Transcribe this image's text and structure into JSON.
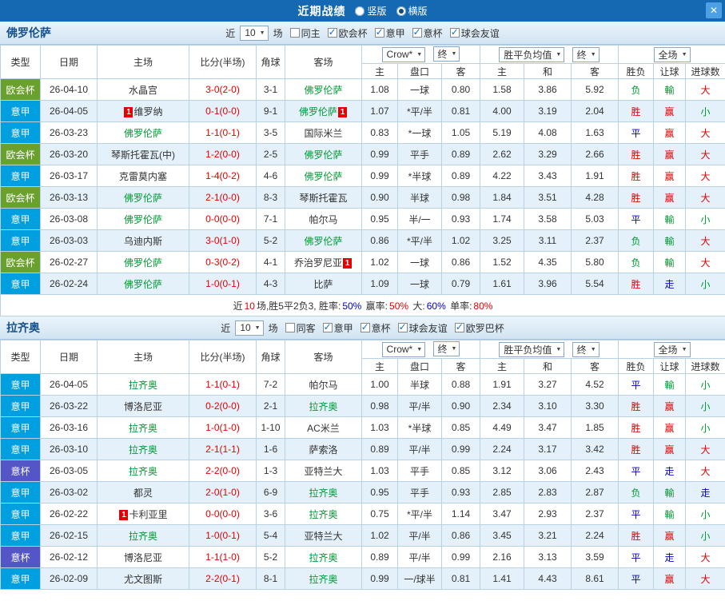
{
  "top_bar": {
    "title": "近期战绩",
    "layout_options": [
      {
        "label": "竖版",
        "selected": false
      },
      {
        "label": "横版",
        "selected": true
      }
    ],
    "close_label": "✕"
  },
  "labels": {
    "near": "近",
    "games": "场",
    "red_card": "1"
  },
  "columns": {
    "type": "类型",
    "date": "日期",
    "home": "主场",
    "score": "比分(半场)",
    "corner": "角球",
    "away": "客场",
    "ah_home": "主",
    "handicap": "盘口",
    "ah_away": "客",
    "odds_home": "主",
    "odds_draw": "和",
    "odds_away": "客",
    "wdl": "胜负",
    "ah_result": "让球",
    "goals": "进球数"
  },
  "colors": {
    "top_bar": "#1568b2",
    "type_badges": {
      "欧会杯": "#6aa02c",
      "意甲": "#00a0e0",
      "意杯": "#5456c8"
    },
    "results": {
      "r": "#e60000",
      "g": "#009933",
      "b": "#0000cc"
    },
    "score": "#e60000",
    "self_team": "#009933"
  },
  "sections": [
    {
      "team": "佛罗伦萨",
      "filter": {
        "count": "10",
        "checkboxes": [
          {
            "label": "同主",
            "checked": false
          },
          {
            "label": "欧会杯",
            "checked": true
          },
          {
            "label": "意甲",
            "checked": true
          },
          {
            "label": "意杯",
            "checked": true
          },
          {
            "label": "球会友谊",
            "checked": true
          }
        ]
      },
      "dropdowns": {
        "source": "Crow*",
        "final1": "终",
        "avg": "胜平负均值",
        "final2": "终",
        "scope": "全场"
      },
      "rows": [
        {
          "type": "欧会杯",
          "date": "26-04-10",
          "home": {
            "name": "水晶宫"
          },
          "score": "3-0(2-0)",
          "corner": "3-1",
          "away": {
            "name": "佛罗伦萨",
            "self": true
          },
          "ah": [
            "1.08",
            "一球",
            "0.80"
          ],
          "odds": [
            "1.58",
            "3.86",
            "5.92"
          ],
          "res": [
            [
              "负",
              "g"
            ],
            [
              "輸",
              "g"
            ],
            [
              "大",
              "r"
            ]
          ]
        },
        {
          "type": "意甲",
          "date": "26-04-05",
          "home": {
            "name": "维罗纳",
            "rc": "before"
          },
          "score": "0-1(0-0)",
          "corner": "9-1",
          "away": {
            "name": "佛罗伦萨",
            "self": true,
            "rc": "after"
          },
          "ah": [
            "1.07",
            "*平/半",
            "0.81"
          ],
          "odds": [
            "4.00",
            "3.19",
            "2.04"
          ],
          "res": [
            [
              "胜",
              "r"
            ],
            [
              "赢",
              "r"
            ],
            [
              "小",
              "g"
            ]
          ]
        },
        {
          "type": "意甲",
          "date": "26-03-23",
          "home": {
            "name": "佛罗伦萨",
            "self": true
          },
          "score": "1-1(0-1)",
          "corner": "3-5",
          "away": {
            "name": "国际米兰"
          },
          "ah": [
            "0.83",
            "*一球",
            "1.05"
          ],
          "odds": [
            "5.19",
            "4.08",
            "1.63"
          ],
          "res": [
            [
              "平",
              "b"
            ],
            [
              "赢",
              "r"
            ],
            [
              "大",
              "r"
            ]
          ]
        },
        {
          "type": "欧会杯",
          "date": "26-03-20",
          "home": {
            "name": "琴斯托霍瓦(中)"
          },
          "score": "1-2(0-0)",
          "corner": "2-5",
          "away": {
            "name": "佛罗伦萨",
            "self": true
          },
          "ah": [
            "0.99",
            "平手",
            "0.89"
          ],
          "odds": [
            "2.62",
            "3.29",
            "2.66"
          ],
          "res": [
            [
              "胜",
              "r"
            ],
            [
              "赢",
              "r"
            ],
            [
              "大",
              "r"
            ]
          ]
        },
        {
          "type": "意甲",
          "date": "26-03-17",
          "home": {
            "name": "克雷莫内塞"
          },
          "score": "1-4(0-2)",
          "corner": "4-6",
          "away": {
            "name": "佛罗伦萨",
            "self": true
          },
          "ah": [
            "0.99",
            "*半球",
            "0.89"
          ],
          "odds": [
            "4.22",
            "3.43",
            "1.91"
          ],
          "res": [
            [
              "胜",
              "r"
            ],
            [
              "赢",
              "r"
            ],
            [
              "大",
              "r"
            ]
          ]
        },
        {
          "type": "欧会杯",
          "date": "26-03-13",
          "home": {
            "name": "佛罗伦萨",
            "self": true
          },
          "score": "2-1(0-0)",
          "corner": "8-3",
          "away": {
            "name": "琴斯托霍瓦"
          },
          "ah": [
            "0.90",
            "半球",
            "0.98"
          ],
          "odds": [
            "1.84",
            "3.51",
            "4.28"
          ],
          "res": [
            [
              "胜",
              "r"
            ],
            [
              "赢",
              "r"
            ],
            [
              "大",
              "r"
            ]
          ]
        },
        {
          "type": "意甲",
          "date": "26-03-08",
          "home": {
            "name": "佛罗伦萨",
            "self": true
          },
          "score": "0-0(0-0)",
          "corner": "7-1",
          "away": {
            "name": "帕尔马"
          },
          "ah": [
            "0.95",
            "半/一",
            "0.93"
          ],
          "odds": [
            "1.74",
            "3.58",
            "5.03"
          ],
          "res": [
            [
              "平",
              "b"
            ],
            [
              "輸",
              "g"
            ],
            [
              "小",
              "g"
            ]
          ]
        },
        {
          "type": "意甲",
          "date": "26-03-03",
          "home": {
            "name": "乌迪内斯"
          },
          "score": "3-0(1-0)",
          "corner": "5-2",
          "away": {
            "name": "佛罗伦萨",
            "self": true
          },
          "ah": [
            "0.86",
            "*平/半",
            "1.02"
          ],
          "odds": [
            "3.25",
            "3.11",
            "2.37"
          ],
          "res": [
            [
              "负",
              "g"
            ],
            [
              "輸",
              "g"
            ],
            [
              "大",
              "r"
            ]
          ]
        },
        {
          "type": "欧会杯",
          "date": "26-02-27",
          "home": {
            "name": "佛罗伦萨",
            "self": true
          },
          "score": "0-3(0-2)",
          "corner": "4-1",
          "away": {
            "name": "乔治罗尼亚",
            "rc": "after"
          },
          "ah": [
            "1.02",
            "一球",
            "0.86"
          ],
          "odds": [
            "1.52",
            "4.35",
            "5.80"
          ],
          "res": [
            [
              "负",
              "g"
            ],
            [
              "輸",
              "g"
            ],
            [
              "大",
              "r"
            ]
          ]
        },
        {
          "type": "意甲",
          "date": "26-02-24",
          "home": {
            "name": "佛罗伦萨",
            "self": true
          },
          "score": "1-0(0-1)",
          "corner": "4-3",
          "away": {
            "name": "比萨"
          },
          "ah": [
            "1.09",
            "一球",
            "0.79"
          ],
          "odds": [
            "1.61",
            "3.96",
            "5.54"
          ],
          "res": [
            [
              "胜",
              "r"
            ],
            [
              "走",
              "b"
            ],
            [
              "小",
              "g"
            ]
          ]
        }
      ],
      "summary": [
        {
          "t": "近",
          "c": "#333333"
        },
        {
          "t": "10",
          "c": "#e60000"
        },
        {
          "t": "场,胜5平2负3, 胜率:",
          "c": "#333333"
        },
        {
          "t": "50%",
          "c": "#0000cc"
        },
        {
          "t": " 赢率:",
          "c": "#333333"
        },
        {
          "t": "50%",
          "c": "#e60000"
        },
        {
          "t": " 大:",
          "c": "#333333"
        },
        {
          "t": "60%",
          "c": "#0000cc"
        },
        {
          "t": " 单率:",
          "c": "#333333"
        },
        {
          "t": "80%",
          "c": "#e60000"
        }
      ]
    },
    {
      "team": "拉齐奥",
      "filter": {
        "count": "10",
        "checkboxes": [
          {
            "label": "同客",
            "checked": false
          },
          {
            "label": "意甲",
            "checked": true
          },
          {
            "label": "意杯",
            "checked": true
          },
          {
            "label": "球会友谊",
            "checked": true
          },
          {
            "label": "欧罗巴杯",
            "checked": true
          }
        ]
      },
      "dropdowns": {
        "source": "Crow*",
        "final1": "终",
        "avg": "胜平负均值",
        "final2": "终",
        "scope": "全场"
      },
      "rows": [
        {
          "type": "意甲",
          "date": "26-04-05",
          "home": {
            "name": "拉齐奥",
            "self": true
          },
          "score": "1-1(0-1)",
          "corner": "7-2",
          "away": {
            "name": "帕尔马"
          },
          "ah": [
            "1.00",
            "半球",
            "0.88"
          ],
          "odds": [
            "1.91",
            "3.27",
            "4.52"
          ],
          "res": [
            [
              "平",
              "b"
            ],
            [
              "輸",
              "g"
            ],
            [
              "小",
              "g"
            ]
          ]
        },
        {
          "type": "意甲",
          "date": "26-03-22",
          "home": {
            "name": "博洛尼亚"
          },
          "score": "0-2(0-0)",
          "corner": "2-1",
          "away": {
            "name": "拉齐奥",
            "self": true
          },
          "ah": [
            "0.98",
            "平/半",
            "0.90"
          ],
          "odds": [
            "2.34",
            "3.10",
            "3.30"
          ],
          "res": [
            [
              "胜",
              "r"
            ],
            [
              "赢",
              "r"
            ],
            [
              "小",
              "g"
            ]
          ]
        },
        {
          "type": "意甲",
          "date": "26-03-16",
          "home": {
            "name": "拉齐奥",
            "self": true
          },
          "score": "1-0(1-0)",
          "corner": "1-10",
          "away": {
            "name": "AC米兰"
          },
          "ah": [
            "1.03",
            "*半球",
            "0.85"
          ],
          "odds": [
            "4.49",
            "3.47",
            "1.85"
          ],
          "res": [
            [
              "胜",
              "r"
            ],
            [
              "赢",
              "r"
            ],
            [
              "小",
              "g"
            ]
          ]
        },
        {
          "type": "意甲",
          "date": "26-03-10",
          "home": {
            "name": "拉齐奥",
            "self": true
          },
          "score": "2-1(1-1)",
          "corner": "1-6",
          "away": {
            "name": "萨索洛"
          },
          "ah": [
            "0.89",
            "平/半",
            "0.99"
          ],
          "odds": [
            "2.24",
            "3.17",
            "3.42"
          ],
          "res": [
            [
              "胜",
              "r"
            ],
            [
              "赢",
              "r"
            ],
            [
              "大",
              "r"
            ]
          ]
        },
        {
          "type": "意杯",
          "date": "26-03-05",
          "home": {
            "name": "拉齐奥",
            "self": true
          },
          "score": "2-2(0-0)",
          "corner": "1-3",
          "away": {
            "name": "亚特兰大"
          },
          "ah": [
            "1.03",
            "平手",
            "0.85"
          ],
          "odds": [
            "3.12",
            "3.06",
            "2.43"
          ],
          "res": [
            [
              "平",
              "b"
            ],
            [
              "走",
              "b"
            ],
            [
              "大",
              "r"
            ]
          ]
        },
        {
          "type": "意甲",
          "date": "26-03-02",
          "home": {
            "name": "都灵"
          },
          "score": "2-0(1-0)",
          "corner": "6-9",
          "away": {
            "name": "拉齐奥",
            "self": true
          },
          "ah": [
            "0.95",
            "平手",
            "0.93"
          ],
          "odds": [
            "2.85",
            "2.83",
            "2.87"
          ],
          "res": [
            [
              "负",
              "g"
            ],
            [
              "輸",
              "g"
            ],
            [
              "走",
              "b"
            ]
          ]
        },
        {
          "type": "意甲",
          "date": "26-02-22",
          "home": {
            "name": "卡利亚里",
            "rc": "before"
          },
          "score": "0-0(0-0)",
          "corner": "3-6",
          "away": {
            "name": "拉齐奥",
            "self": true
          },
          "ah": [
            "0.75",
            "*平/半",
            "1.14"
          ],
          "odds": [
            "3.47",
            "2.93",
            "2.37"
          ],
          "res": [
            [
              "平",
              "b"
            ],
            [
              "輸",
              "g"
            ],
            [
              "小",
              "g"
            ]
          ]
        },
        {
          "type": "意甲",
          "date": "26-02-15",
          "home": {
            "name": "拉齐奥",
            "self": true
          },
          "score": "1-0(0-1)",
          "corner": "5-4",
          "away": {
            "name": "亚特兰大"
          },
          "ah": [
            "1.02",
            "平/半",
            "0.86"
          ],
          "odds": [
            "3.45",
            "3.21",
            "2.24"
          ],
          "res": [
            [
              "胜",
              "r"
            ],
            [
              "赢",
              "r"
            ],
            [
              "小",
              "g"
            ]
          ]
        },
        {
          "type": "意杯",
          "date": "26-02-12",
          "home": {
            "name": "博洛尼亚"
          },
          "score": "1-1(1-0)",
          "corner": "5-2",
          "away": {
            "name": "拉齐奥",
            "self": true
          },
          "ah": [
            "0.89",
            "平/半",
            "0.99"
          ],
          "odds": [
            "2.16",
            "3.13",
            "3.59"
          ],
          "res": [
            [
              "平",
              "b"
            ],
            [
              "走",
              "b"
            ],
            [
              "大",
              "r"
            ]
          ]
        },
        {
          "type": "意甲",
          "date": "26-02-09",
          "home": {
            "name": "尤文图斯"
          },
          "score": "2-2(0-1)",
          "corner": "8-1",
          "away": {
            "name": "拉齐奥",
            "self": true
          },
          "ah": [
            "0.99",
            "一/球半",
            "0.81"
          ],
          "odds": [
            "1.41",
            "4.43",
            "8.61"
          ],
          "res": [
            [
              "平",
              "b"
            ],
            [
              "赢",
              "r"
            ],
            [
              "大",
              "r"
            ]
          ]
        }
      ]
    }
  ]
}
